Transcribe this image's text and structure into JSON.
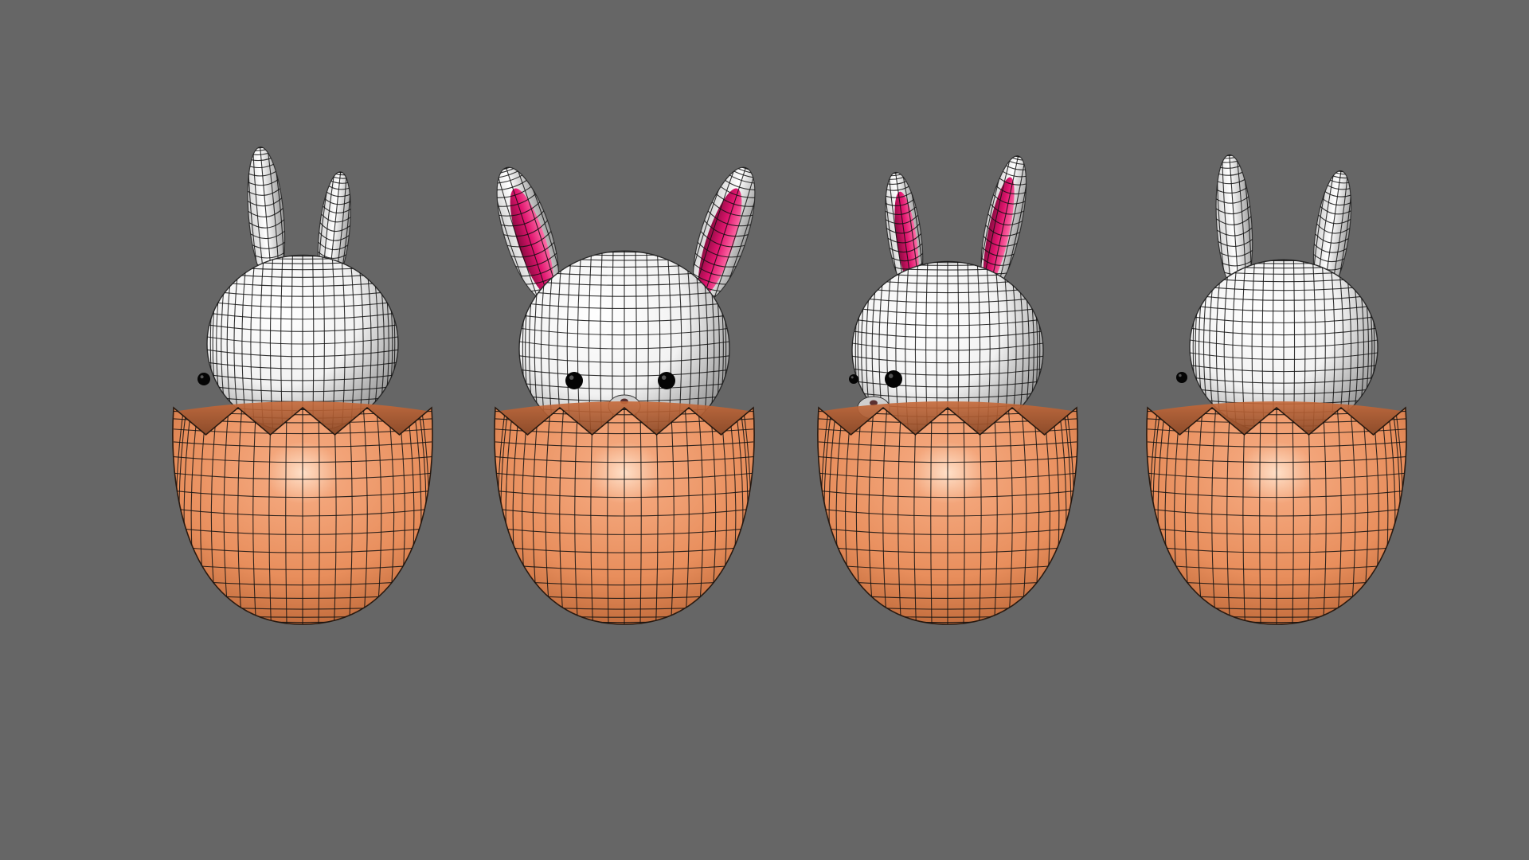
{
  "viewport": {
    "background": "#666666"
  },
  "materials": {
    "fur": "#f2f2f2",
    "fur_shade": "#8c8c8c",
    "shell": "#e88e5c",
    "shell_shade": "#b35f30",
    "shell_highlight": "#ffe0c8",
    "inner_ear": "#e0146e",
    "inner_ear_shade": "#8a0a40",
    "eye": "#050505",
    "wireframe": "#111111"
  },
  "models": [
    {
      "name": "bunny-in-egg-back-left-view",
      "view": "back-left"
    },
    {
      "name": "bunny-in-egg-front-view",
      "view": "front"
    },
    {
      "name": "bunny-in-egg-side-view",
      "view": "left"
    },
    {
      "name": "bunny-in-egg-back-view",
      "view": "back"
    }
  ]
}
